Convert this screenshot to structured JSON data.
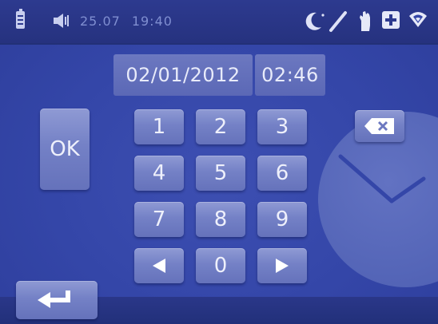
{
  "status_bar": {
    "date": "25.07",
    "time": "19:40",
    "icons": [
      "battery-icon",
      "speaker-icon",
      "moon-pen-icon",
      "hand-icon",
      "plus-icon",
      "wifi-icon"
    ]
  },
  "datetime": {
    "date_value": "02/01/2012",
    "time_value": "02:46"
  },
  "keypad": {
    "ok_label": "OK",
    "keys": [
      "1",
      "2",
      "3",
      "4",
      "5",
      "6",
      "7",
      "8",
      "9"
    ],
    "zero": "0"
  },
  "colors": {
    "background": "#3446a8",
    "button": "#7481c6",
    "text": "#eef0fb"
  }
}
